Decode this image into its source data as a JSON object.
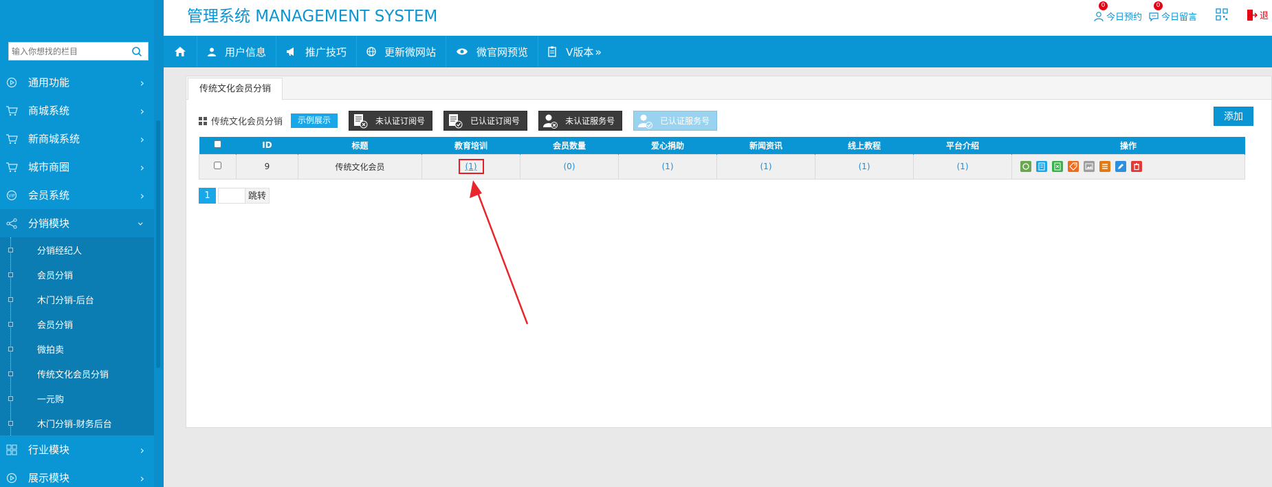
{
  "header": {
    "brand": "管理系统 MANAGEMENT SYSTEM",
    "links": [
      {
        "label": "今日预约",
        "badge": "0"
      },
      {
        "label": "今日留言",
        "badge": "0"
      }
    ],
    "logout_label": "退"
  },
  "search": {
    "placeholder": "输入你想找的栏目"
  },
  "sidebar": {
    "items_top": [
      {
        "label": "通用功能",
        "icon": "play-circle-icon"
      },
      {
        "label": "商城系统",
        "icon": "cart-icon"
      },
      {
        "label": "新商城系统",
        "icon": "cart-icon"
      },
      {
        "label": "城市商圈",
        "icon": "cart-icon"
      },
      {
        "label": "会员系统",
        "icon": "vip-icon"
      },
      {
        "label": "分销模块",
        "icon": "share-icon"
      }
    ],
    "submenu": [
      "分销经纪人",
      "会员分销",
      "木门分销-后台",
      "会员分销",
      "微拍卖",
      "传统文化会员分销",
      "一元购",
      "木门分销-财务后台"
    ],
    "items_bottom": [
      {
        "label": "行业模块",
        "icon": "grid-icon"
      },
      {
        "label": "展示模块",
        "icon": "play-circle-icon"
      }
    ]
  },
  "nav": [
    {
      "label": "",
      "icon": "home-icon"
    },
    {
      "label": "用户信息",
      "icon": "user-icon"
    },
    {
      "label": "推广技巧",
      "icon": "megaphone-icon"
    },
    {
      "label": "更新微网站",
      "icon": "globe-icon"
    },
    {
      "label": "微官网预览",
      "icon": "eye-icon"
    },
    {
      "label": "V版本",
      "icon": "clipboard-icon"
    }
  ],
  "content": {
    "tab": "传统文化会员分销",
    "toolbar_label": "传统文化会员分销",
    "demo_button": "示例展示",
    "account_buttons": [
      "未认证订阅号",
      "已认证订阅号",
      "未认证服务号",
      "已认证服务号"
    ],
    "add_button": "添加",
    "table": {
      "headers": [
        "",
        "ID",
        "标题",
        "教育培训",
        "会员数量",
        "爱心捐助",
        "新闻资讯",
        "线上教程",
        "平台介绍",
        "操作"
      ],
      "rows": [
        {
          "id": "9",
          "title": "传统文化会员",
          "edu": "(1)",
          "members": "(0)",
          "charity": "(1)",
          "news": "(1)",
          "online": "(1)",
          "intro": "(1)"
        }
      ]
    },
    "pager": {
      "current": "1",
      "go_label": "跳转"
    }
  }
}
